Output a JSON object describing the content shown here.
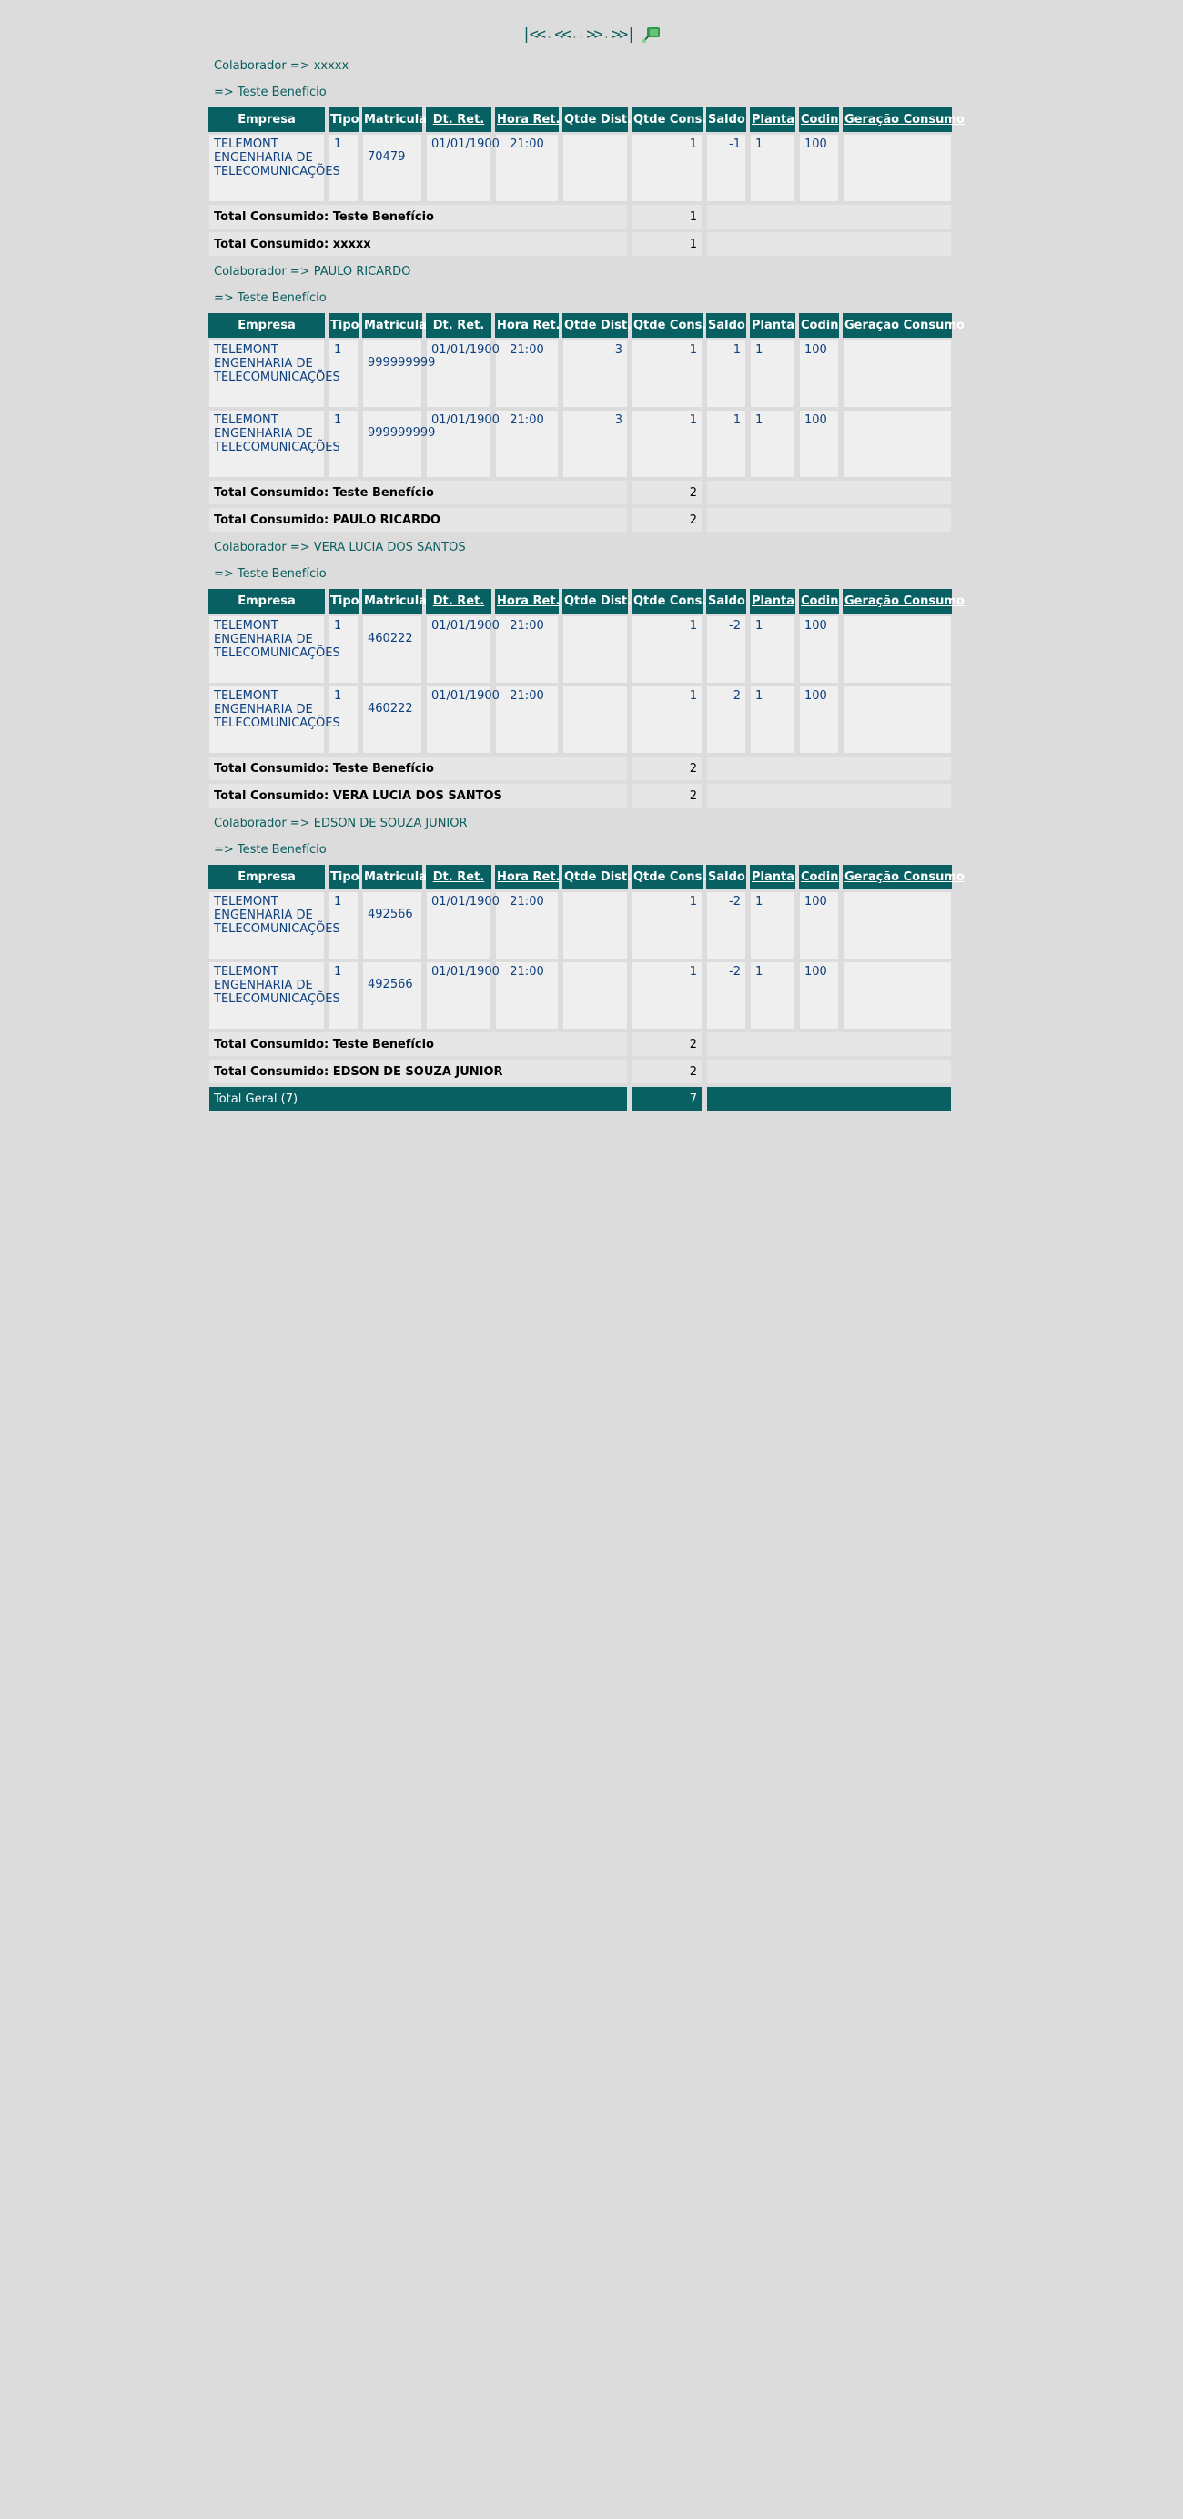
{
  "pager": {
    "first": "|<<",
    "prev": "<<",
    "dots": "..",
    "next": ">>",
    "last": ">>|",
    "export_icon": "excel-export-icon"
  },
  "headers": {
    "empresa": "Empresa",
    "tipo": "Tipo",
    "matricula": "Matricula",
    "dt_ret": "Dt. Ret.",
    "hora_ret": "Hora Ret.",
    "qtde_dist": "Qtde Dist.",
    "qtde_cons": "Qtde Cons.",
    "saldo": "Saldo",
    "planta": "Planta",
    "codin": "Codin",
    "geracao": "Geração Consumo"
  },
  "groups": [
    {
      "colaborador": "Colaborador => xxxxx",
      "beneficio": "=> Teste Benefício",
      "rows": [
        {
          "empresa": "TELEMONT ENGENHARIA DE TELECOMUNICAÇÕES",
          "tipo": "1",
          "matricula": "70479",
          "dt": "01/01/1900",
          "hora": "21:00",
          "dist": "",
          "cons": "1",
          "saldo": "-1",
          "planta": "1",
          "codin": "100",
          "geracao": ""
        }
      ],
      "tot_benef_label": "Total Consumido: Teste Benefício",
      "tot_benef_value": "1",
      "tot_colab_label": "Total Consumido: xxxxx",
      "tot_colab_value": "1"
    },
    {
      "colaborador": "Colaborador => PAULO RICARDO",
      "beneficio": "=> Teste Benefício",
      "rows": [
        {
          "empresa": "TELEMONT ENGENHARIA DE TELECOMUNICAÇÕES",
          "tipo": "1",
          "matricula": "999999999",
          "dt": "01/01/1900",
          "hora": "21:00",
          "dist": "3",
          "cons": "1",
          "saldo": "1",
          "planta": "1",
          "codin": "100",
          "geracao": ""
        },
        {
          "empresa": "TELEMONT ENGENHARIA DE TELECOMUNICAÇÕES",
          "tipo": "1",
          "matricula": "999999999",
          "dt": "01/01/1900",
          "hora": "21:00",
          "dist": "3",
          "cons": "1",
          "saldo": "1",
          "planta": "1",
          "codin": "100",
          "geracao": ""
        }
      ],
      "tot_benef_label": "Total Consumido: Teste Benefício",
      "tot_benef_value": "2",
      "tot_colab_label": "Total Consumido: PAULO RICARDO",
      "tot_colab_value": "2"
    },
    {
      "colaborador": "Colaborador => VERA LUCIA DOS SANTOS",
      "beneficio": "=> Teste Benefício",
      "rows": [
        {
          "empresa": "TELEMONT ENGENHARIA DE TELECOMUNICAÇÕES",
          "tipo": "1",
          "matricula": "460222",
          "dt": "01/01/1900",
          "hora": "21:00",
          "dist": "",
          "cons": "1",
          "saldo": "-2",
          "planta": "1",
          "codin": "100",
          "geracao": ""
        },
        {
          "empresa": "TELEMONT ENGENHARIA DE TELECOMUNICAÇÕES",
          "tipo": "1",
          "matricula": "460222",
          "dt": "01/01/1900",
          "hora": "21:00",
          "dist": "",
          "cons": "1",
          "saldo": "-2",
          "planta": "1",
          "codin": "100",
          "geracao": ""
        }
      ],
      "tot_benef_label": "Total Consumido: Teste Benefício",
      "tot_benef_value": "2",
      "tot_colab_label": "Total Consumido: VERA LUCIA DOS SANTOS",
      "tot_colab_value": "2"
    },
    {
      "colaborador": "Colaborador => EDSON DE SOUZA JUNIOR",
      "beneficio": "=> Teste Benefício",
      "rows": [
        {
          "empresa": "TELEMONT ENGENHARIA DE TELECOMUNICAÇÕES",
          "tipo": "1",
          "matricula": "492566",
          "dt": "01/01/1900",
          "hora": "21:00",
          "dist": "",
          "cons": "1",
          "saldo": "-2",
          "planta": "1",
          "codin": "100",
          "geracao": ""
        },
        {
          "empresa": "TELEMONT ENGENHARIA DE TELECOMUNICAÇÕES",
          "tipo": "1",
          "matricula": "492566",
          "dt": "01/01/1900",
          "hora": "21:00",
          "dist": "",
          "cons": "1",
          "saldo": "-2",
          "planta": "1",
          "codin": "100",
          "geracao": ""
        }
      ],
      "tot_benef_label": "Total Consumido: Teste Benefício",
      "tot_benef_value": "2",
      "tot_colab_label": "Total Consumido: EDSON DE SOUZA JUNIOR",
      "tot_colab_value": "2"
    }
  ],
  "grand_total": {
    "label": "Total Geral (7)",
    "value": "7"
  },
  "colors": {
    "header_bg": "#096062",
    "page_bg": "#dcdcdc",
    "cell_text": "#0c3f7f",
    "label_text": "#0a5d5d"
  }
}
